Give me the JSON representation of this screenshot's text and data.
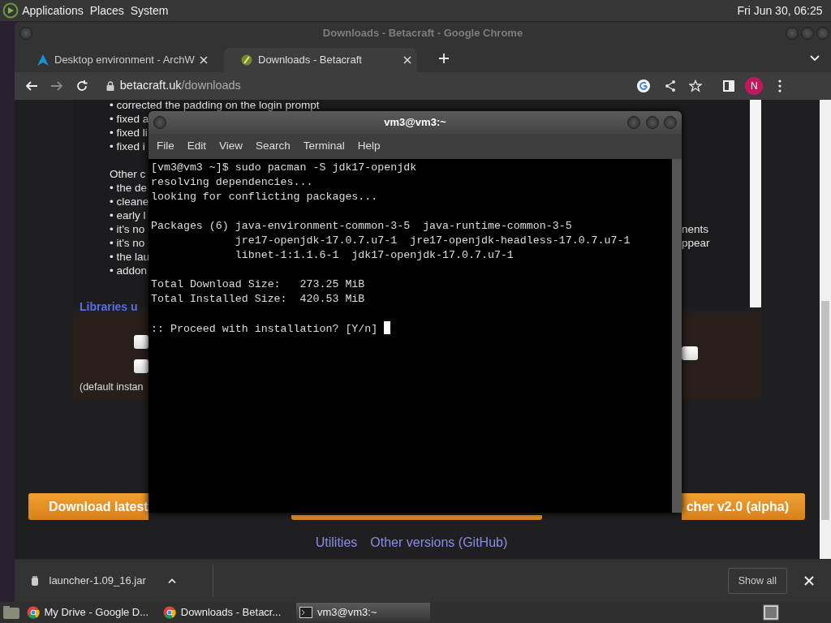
{
  "top_panel": {
    "menus": [
      "Applications",
      "Places",
      "System"
    ],
    "clock": "Fri Jun 30, 06:25"
  },
  "browser": {
    "title": "Downloads - Betacraft - Google Chrome",
    "tabs": [
      {
        "label": "Desktop environment - ArchW",
        "selected": false
      },
      {
        "label": "Downloads - Betacraft",
        "selected": true
      }
    ],
    "address": {
      "host": "betacraft.uk",
      "path": "/downloads"
    },
    "profile_initial": "N",
    "page": {
      "changelog": [
        [
          {
            "text": "• corrected the padding on the login prompt"
          },
          {
            "text": "• fixed a"
          },
          {
            "text": "• fixed li"
          },
          {
            "text": "• fixed i"
          }
        ],
        [
          {
            "text": "Other c"
          },
          {
            "text": "• the de"
          },
          {
            "text": "• cleane"
          },
          {
            "text": "• early l"
          },
          {
            "text": "• it's no",
            "tail": "nents"
          },
          {
            "text": "• it's no",
            "tail": "ppear"
          },
          {
            "text": "• the lau"
          },
          {
            "text": "• addon"
          }
        ]
      ],
      "libraries_heading": "Libraries u",
      "default_note": "(default instan",
      "download_buttons": [
        {
          "kind": "label",
          "label": "Download latest"
        },
        {
          "kind": "covered"
        },
        {
          "kind": "label",
          "label": "cher v2.0 (alpha)"
        }
      ],
      "links": [
        "Utilities",
        "Other versions (GitHub)"
      ]
    },
    "downloads_bar": {
      "file": "launcher-1.09_16.jar",
      "show_all": "Show all"
    }
  },
  "terminal": {
    "title": "vm3@vm3:~",
    "menus": [
      "File",
      "Edit",
      "View",
      "Search",
      "Terminal",
      "Help"
    ],
    "blocks": [
      [
        "[vm3@vm3 ~]$ sudo pacman -S jdk17-openjdk",
        "resolving dependencies...",
        "looking for conflicting packages..."
      ],
      [
        "Packages (6) java-environment-common-3-5  java-runtime-common-3-5",
        "             jre17-openjdk-17.0.7.u7-1  jre17-openjdk-headless-17.0.7.u7-1",
        "             libnet-1:1.1.6-1  jdk17-openjdk-17.0.7.u7-1"
      ],
      [
        "Total Download Size:   273.25 MiB",
        "Total Installed Size:  420.53 MiB"
      ],
      [
        ":: Proceed with installation? [Y/n] "
      ]
    ]
  },
  "taskbar": {
    "items": [
      {
        "label": "My Drive - Google D...",
        "kind": "chrome",
        "selected": false
      },
      {
        "label": "Downloads - Betacr...",
        "kind": "chrome",
        "selected": false
      },
      {
        "label": "vm3@vm3:~",
        "kind": "terminal",
        "selected": true
      }
    ]
  }
}
